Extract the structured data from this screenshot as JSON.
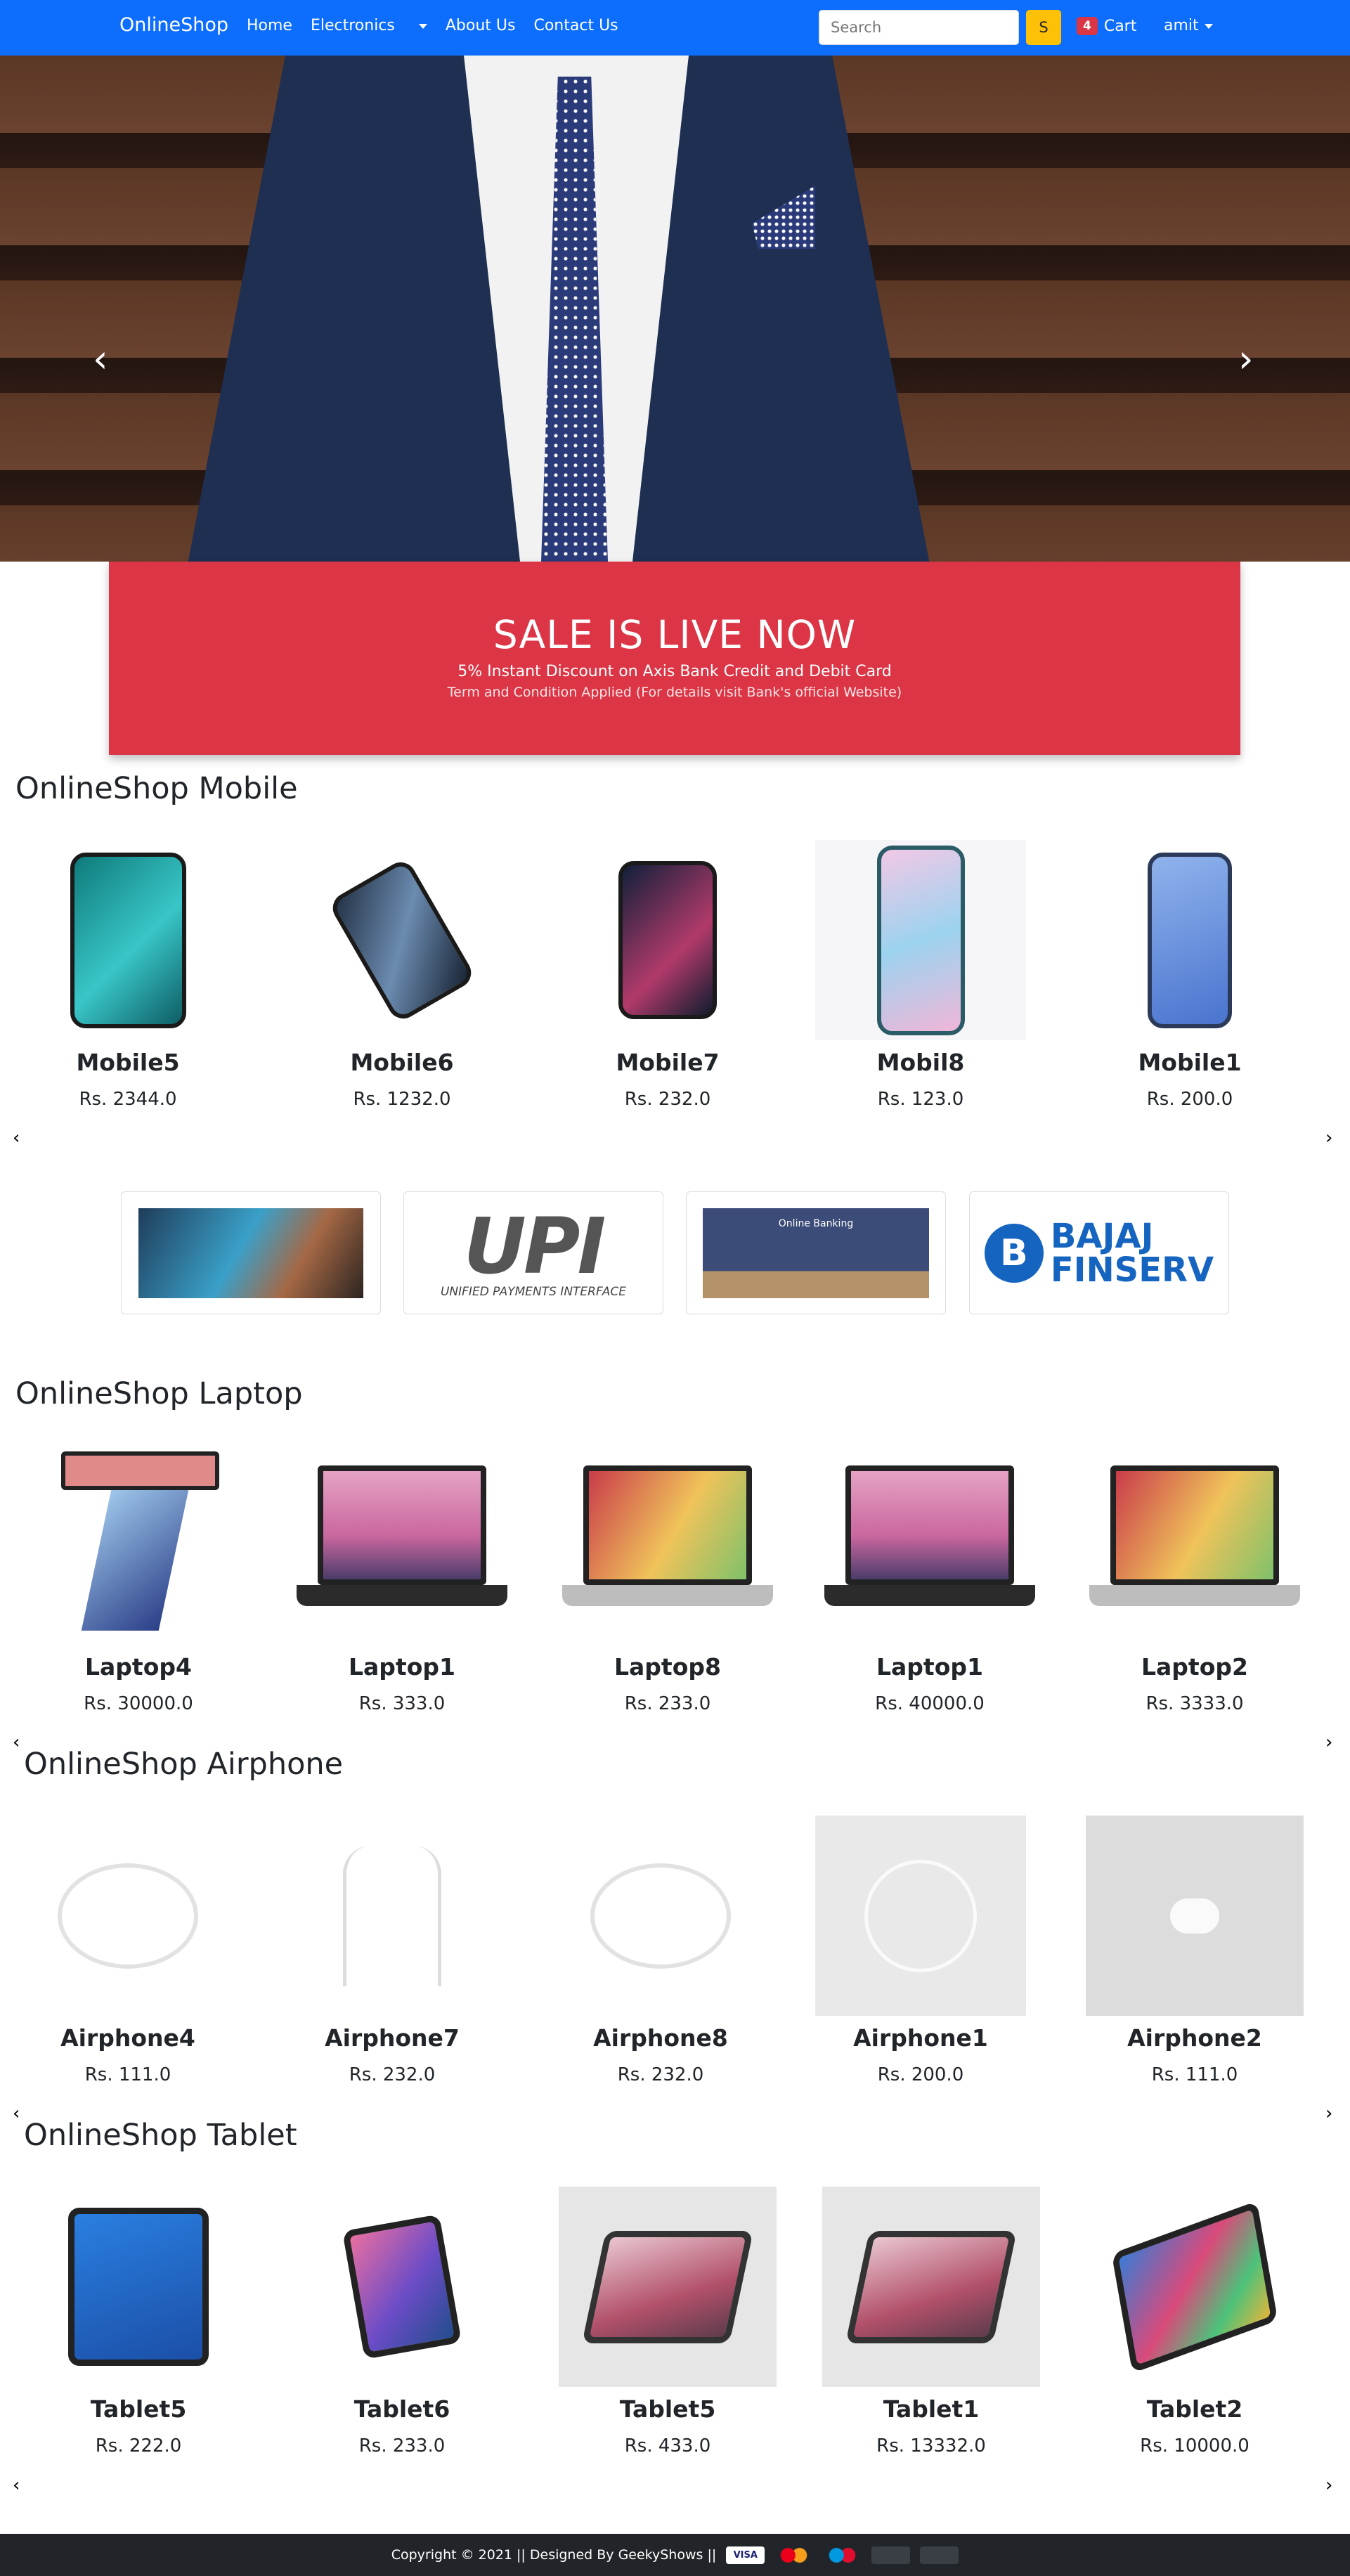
{
  "nav": {
    "brand": "OnlineShop",
    "links": [
      "Home",
      "Electronics",
      "About Us",
      "Contact Us"
    ],
    "search_placeholder": "Search",
    "search_button": "S",
    "cart_count": "4",
    "cart_label": "Cart",
    "user": "amit"
  },
  "carousel": {
    "prev": "‹",
    "next": "›"
  },
  "sale": {
    "title": "SALE IS LIVE NOW",
    "line1": "5% Instant Discount on Axis Bank Credit and Debit Card",
    "line2": "Term and Condition Applied (For details visit Bank's official Website)"
  },
  "sections": [
    {
      "title": "OnlineShop Mobile",
      "items": [
        {
          "name": "Mobile5",
          "price": "Rs. 2344.0"
        },
        {
          "name": "Mobile6",
          "price": "Rs. 1232.0"
        },
        {
          "name": "Mobile7",
          "price": "Rs. 232.0"
        },
        {
          "name": "Mobil8",
          "price": "Rs. 123.0"
        },
        {
          "name": "Mobile1",
          "price": "Rs. 200.0"
        }
      ]
    },
    {
      "title": "OnlineShop Laptop",
      "items": [
        {
          "name": "Laptop4",
          "price": "Rs. 30000.0"
        },
        {
          "name": "Laptop1",
          "price": "Rs. 333.0"
        },
        {
          "name": "Laptop8",
          "price": "Rs. 233.0"
        },
        {
          "name": "Laptop1",
          "price": "Rs. 40000.0"
        },
        {
          "name": "Laptop2",
          "price": "Rs. 3333.0"
        }
      ]
    },
    {
      "title": "OnlineShop Airphone",
      "items": [
        {
          "name": "Airphone4",
          "price": "Rs. 111.0"
        },
        {
          "name": "Airphone7",
          "price": "Rs. 232.0"
        },
        {
          "name": "Airphone8",
          "price": "Rs. 232.0"
        },
        {
          "name": "Airphone1",
          "price": "Rs. 200.0"
        },
        {
          "name": "Airphone2",
          "price": "Rs. 111.0"
        }
      ]
    },
    {
      "title": "OnlineShop Tablet",
      "items": [
        {
          "name": "Tablet5",
          "price": "Rs. 222.0"
        },
        {
          "name": "Tablet6",
          "price": "Rs. 233.0"
        },
        {
          "name": "Tablet5",
          "price": "Rs. 433.0"
        },
        {
          "name": "Tablet1",
          "price": "Rs. 13332.0"
        },
        {
          "name": "Tablet2",
          "price": "Rs. 10000.0"
        }
      ]
    }
  ],
  "payments": {
    "upi_logo": "UPI",
    "upi_sub": "UNIFIED PAYMENTS INTERFACE",
    "netbanking": "Online Banking",
    "bajaj1": "BAJAJ",
    "bajaj2": "FINSERV"
  },
  "footer": {
    "text": "Copyright © 2021 || Designed By GeekyShows ||",
    "visa": "VISA"
  },
  "colors": {
    "nav": "#0d6efd",
    "sale": "#dc3545",
    "footer": "#212529",
    "search_btn": "#ffc107"
  }
}
